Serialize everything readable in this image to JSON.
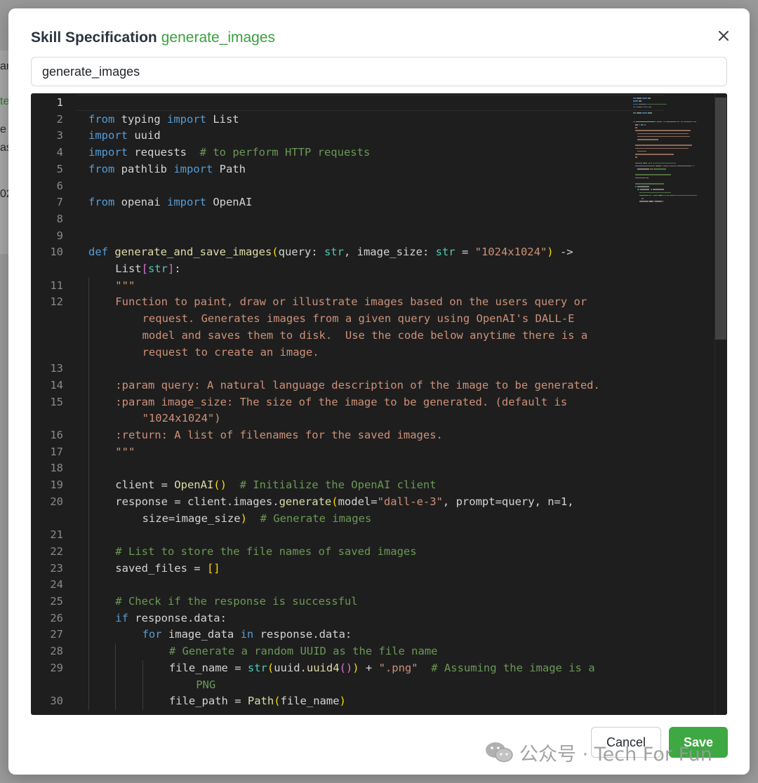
{
  "background": {
    "peek_chars": [
      "an",
      "te",
      "e",
      "as",
      "02"
    ]
  },
  "modal": {
    "title": "Skill Specification",
    "skill_name": "generate_images",
    "close_icon": "close-icon",
    "name_input_value": "generate_images",
    "cancel_label": "Cancel",
    "save_label": "Save"
  },
  "colors": {
    "accent": "#3ea843",
    "editor_bg": "#1e1e1e"
  },
  "editor": {
    "line_numbers": [
      "1",
      "2",
      "3",
      "4",
      "5",
      "6",
      "7",
      "8",
      "9",
      "10",
      "",
      "11",
      "12",
      "",
      "",
      "",
      "13",
      "14",
      "15",
      "",
      "16",
      "17",
      "18",
      "19",
      "20",
      "",
      "21",
      "22",
      "23",
      "24",
      "25",
      "26",
      "27",
      "28",
      "29",
      "",
      "30"
    ],
    "lines": [
      [
        [
          "",
          "",
          0
        ]
      ],
      [
        [
          "kw",
          "from",
          0
        ],
        [
          "",
          "typing",
          0
        ],
        [
          "kw",
          "import",
          0
        ],
        [
          "",
          "List",
          0
        ]
      ],
      [
        [
          "kw",
          "import",
          0
        ],
        [
          "",
          "uuid",
          0
        ]
      ],
      [
        [
          "kw",
          "import",
          0
        ],
        [
          "",
          "requests  ",
          0
        ],
        [
          "cm",
          "# to perform HTTP requests",
          0
        ]
      ],
      [
        [
          "kw",
          "from",
          0
        ],
        [
          "",
          "pathlib",
          0
        ],
        [
          "kw",
          "import",
          0
        ],
        [
          "",
          "Path",
          0
        ]
      ],
      [
        [
          "",
          "",
          0
        ]
      ],
      [
        [
          "kw",
          "from",
          0
        ],
        [
          "",
          "openai",
          0
        ],
        [
          "kw",
          "import",
          0
        ],
        [
          "",
          "OpenAI",
          0
        ]
      ],
      [
        [
          "",
          "",
          0
        ]
      ],
      [
        [
          "",
          "",
          0
        ]
      ],
      [
        [
          "kw",
          "def",
          0
        ],
        [
          "fn",
          "generate_and_save_images",
          0
        ],
        [
          "br",
          "(",
          0
        ],
        [
          "",
          "query: ",
          0
        ],
        [
          "ty",
          "str",
          0
        ],
        [
          "",
          ", image_size: ",
          0
        ],
        [
          "ty",
          "str",
          0
        ],
        [
          "",
          " = ",
          0
        ],
        [
          "str",
          "\"1024x1024\"",
          0
        ],
        [
          "br",
          ")",
          0
        ],
        [
          "",
          " ->",
          0
        ]
      ],
      [
        [
          "",
          "List",
          1
        ],
        [
          "br2",
          "[",
          1
        ],
        [
          "ty",
          "str",
          1
        ],
        [
          "br2",
          "]",
          1
        ],
        [
          "",
          ":",
          1
        ]
      ],
      [
        [
          "str",
          "\"\"\"",
          1
        ]
      ],
      [
        [
          "str",
          "Function to paint, draw or illustrate images based on the users query or",
          1
        ]
      ],
      [
        [
          "str",
          "request. Generates images from a given query using OpenAI's DALL-E",
          2
        ]
      ],
      [
        [
          "str",
          "model and saves them to disk.  Use the code below anytime there is a",
          2
        ]
      ],
      [
        [
          "str",
          "request to create an image.",
          2
        ]
      ],
      [
        [
          "",
          "",
          0
        ]
      ],
      [
        [
          "str",
          ":param query: A natural language description of the image to be generated.",
          1
        ]
      ],
      [
        [
          "str",
          ":param image_size: The size of the image to be generated. (default is",
          1
        ]
      ],
      [
        [
          "str",
          "\"1024x1024\")",
          2
        ]
      ],
      [
        [
          "str",
          ":return: A list of filenames for the saved images.",
          1
        ]
      ],
      [
        [
          "str",
          "\"\"\"",
          1
        ]
      ],
      [
        [
          "",
          "",
          0
        ]
      ],
      [
        [
          "",
          "client = ",
          1
        ],
        [
          "fn",
          "OpenAI",
          1
        ],
        [
          "br",
          "()",
          1
        ],
        [
          "",
          "  ",
          1
        ],
        [
          "cm",
          "# Initialize the OpenAI client",
          1
        ]
      ],
      [
        [
          "",
          "response = client.images.",
          1
        ],
        [
          "fn",
          "generate",
          1
        ],
        [
          "br",
          "(",
          1
        ],
        [
          "",
          "model=",
          1
        ],
        [
          "str",
          "\"dall-e-3\"",
          1
        ],
        [
          "",
          ", prompt=query, n=",
          1
        ],
        [
          "",
          "1",
          1
        ],
        [
          "",
          ",",
          1
        ]
      ],
      [
        [
          "",
          "size=image_size",
          2
        ],
        [
          "br",
          ")",
          2
        ],
        [
          "",
          "  ",
          2
        ],
        [
          "cm",
          "# Generate images",
          2
        ]
      ],
      [
        [
          "",
          "",
          0
        ]
      ],
      [
        [
          "cm",
          "# List to store the file names of saved images",
          1
        ]
      ],
      [
        [
          "",
          "saved_files = ",
          1
        ],
        [
          "br",
          "[]",
          1
        ]
      ],
      [
        [
          "",
          "",
          0
        ]
      ],
      [
        [
          "cm",
          "# Check if the response is successful",
          1
        ]
      ],
      [
        [
          "kw",
          "if",
          1
        ],
        [
          "",
          " response.data:",
          1
        ]
      ],
      [
        [
          "kw",
          "for",
          2
        ],
        [
          "",
          " image_data ",
          2
        ],
        [
          "kw",
          "in",
          2
        ],
        [
          "",
          " response.data:",
          2
        ]
      ],
      [
        [
          "cm",
          "# Generate a random UUID as the file name",
          3
        ]
      ],
      [
        [
          "",
          "file_name = ",
          3
        ],
        [
          "ty",
          "str",
          3
        ],
        [
          "br",
          "(",
          3
        ],
        [
          "",
          "uuid.",
          3
        ],
        [
          "fn",
          "uuid4",
          3
        ],
        [
          "br2",
          "()",
          3
        ],
        [
          "br",
          ")",
          3
        ],
        [
          "",
          " + ",
          3
        ],
        [
          "str",
          "\".png\"",
          3
        ],
        [
          "",
          "  ",
          3
        ],
        [
          "cm",
          "# Assuming the image is a",
          3
        ]
      ],
      [
        [
          "cm",
          "PNG",
          4
        ]
      ],
      [
        [
          "",
          "file_path = ",
          3
        ],
        [
          "fn",
          "Path",
          3
        ],
        [
          "br",
          "(",
          3
        ],
        [
          "",
          "file_name",
          3
        ],
        [
          "br",
          ")",
          3
        ]
      ]
    ]
  },
  "watermark": {
    "text": "公众号 · Tech For Fun"
  }
}
